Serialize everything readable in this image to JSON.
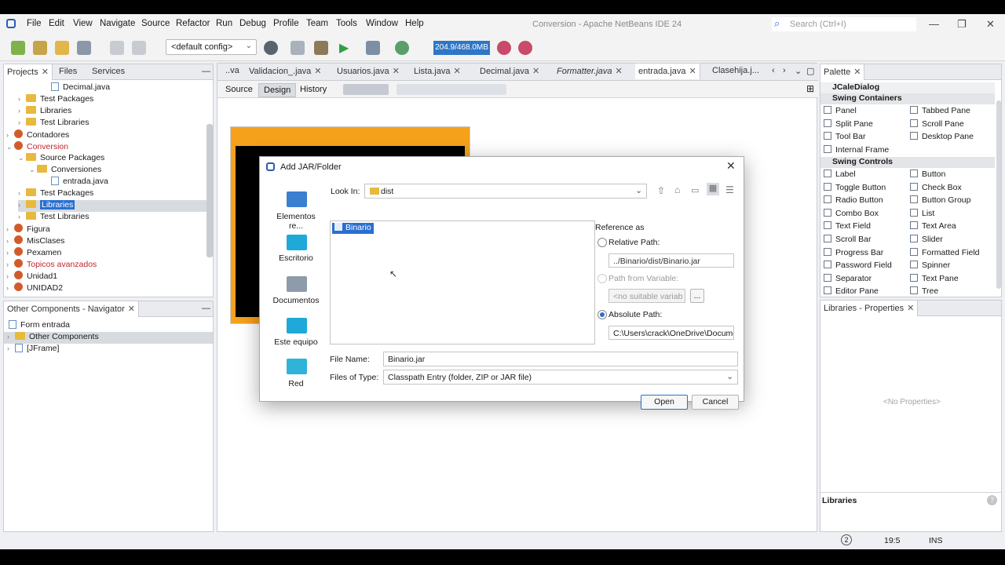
{
  "window": {
    "title": "Conversion - Apache NetBeans IDE 24",
    "search_placeholder": "Search (Ctrl+I)"
  },
  "menubar": [
    "File",
    "Edit",
    "View",
    "Navigate",
    "Source",
    "Refactor",
    "Run",
    "Debug",
    "Profile",
    "Team",
    "Tools",
    "Window",
    "Help"
  ],
  "toolbar": {
    "config": "<default config>",
    "memory": "204.9/468.0MB"
  },
  "projects_panel": {
    "tabs": [
      "Projects",
      "Files",
      "Services"
    ],
    "tree": [
      {
        "label": "Decimal.java",
        "kind": "file"
      },
      {
        "label": "Test Packages",
        "kind": "folder"
      },
      {
        "label": "Libraries",
        "kind": "folder"
      },
      {
        "label": "Test Libraries",
        "kind": "folder"
      },
      {
        "label": "Contadores",
        "kind": "project"
      },
      {
        "label": "Conversion",
        "kind": "project"
      },
      {
        "label": "Source Packages",
        "kind": "folder"
      },
      {
        "label": "Conversiones",
        "kind": "folder"
      },
      {
        "label": "entrada.java",
        "kind": "file"
      },
      {
        "label": "Test Packages",
        "kind": "folder"
      },
      {
        "label": "Libraries",
        "kind": "folder"
      },
      {
        "label": "Test Libraries",
        "kind": "folder"
      },
      {
        "label": "Figura",
        "kind": "project"
      },
      {
        "label": "MisClases",
        "kind": "project"
      },
      {
        "label": "Pexamen",
        "kind": "project"
      },
      {
        "label": "Topicos avanzados",
        "kind": "project"
      },
      {
        "label": "Unidad1",
        "kind": "project"
      },
      {
        "label": "UNIDAD2",
        "kind": "project"
      }
    ]
  },
  "navigator_panel": {
    "tab": "Other Components - Navigator",
    "tree": [
      "Form entrada",
      "Other Components",
      "[JFrame]"
    ]
  },
  "editor": {
    "tabs": [
      "..va",
      "Validacion_.java",
      "Usuarios.java",
      "Lista.java",
      "Decimal.java",
      "Formatter.java",
      "entrada.java",
      "Clasehija.j..."
    ],
    "modes": [
      "Source",
      "Design",
      "History"
    ]
  },
  "palette": {
    "tab": "Palette",
    "top_item": "JCaleDialog",
    "categories": {
      "containers": "Swing Containers",
      "controls": "Swing Controls"
    },
    "containers": [
      "Panel",
      "Tabbed Pane",
      "Split Pane",
      "Scroll Pane",
      "Tool Bar",
      "Desktop Pane",
      "Internal Frame"
    ],
    "controls": [
      "Label",
      "Button",
      "Toggle Button",
      "Check Box",
      "Radio Button",
      "Button Group",
      "Combo Box",
      "List",
      "Text Field",
      "Text Area",
      "Scroll Bar",
      "Slider",
      "Progress Bar",
      "Formatted Field",
      "Password Field",
      "Spinner",
      "Separator",
      "Text Pane",
      "Editor Pane",
      "Tree"
    ]
  },
  "properties_panel": {
    "tab": "Libraries - Properties",
    "empty_text": "<No Properties>",
    "footer": "Libraries"
  },
  "dialog": {
    "title": "Add JAR/Folder",
    "places": [
      "Elementos re...",
      "Escritorio",
      "Documentos",
      "Este equipo",
      "Red"
    ],
    "look_in_label": "Look In:",
    "look_in_value": "dist",
    "file_list": [
      "Binario"
    ],
    "reference_as": "Reference as",
    "relative_path_label": "Relative Path:",
    "relative_path_value": "../Binario/dist/Binario.jar",
    "path_from_variable_label": "Path from Variable:",
    "variable_value": "<no suitable variab",
    "variable_button": "...",
    "absolute_path_label": "Absolute Path:",
    "absolute_path_value": "C:\\Users\\crack\\OneDrive\\Docume",
    "file_name_label": "File Name:",
    "file_name_value": "Binario.jar",
    "files_of_type_label": "Files of Type:",
    "files_of_type_value": "Classpath Entry (folder, ZIP or JAR file)",
    "open_button": "Open",
    "cancel_button": "Cancel"
  },
  "statusbar": {
    "notifications": "2",
    "position": "19:5",
    "mode": "INS"
  },
  "colors": {
    "accent": "#2a6fd0",
    "form_border": "#f5a11b",
    "memory_bar": "#2f76c7"
  }
}
